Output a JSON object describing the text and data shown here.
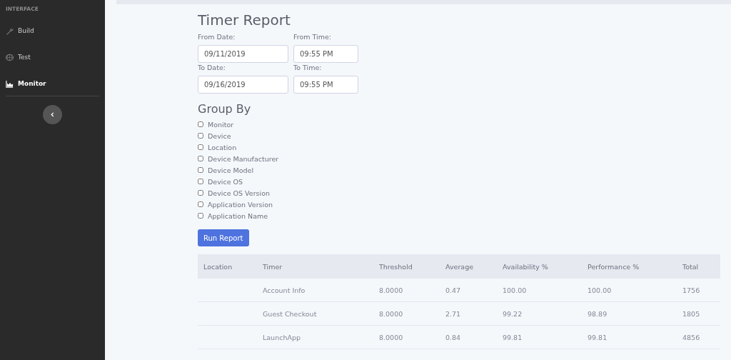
{
  "sidebar": {
    "heading": "INTERFACE",
    "items": [
      {
        "label": "Build",
        "selected": false
      },
      {
        "label": "Test",
        "selected": false
      },
      {
        "label": "Monitor",
        "selected": true
      }
    ]
  },
  "page": {
    "title": "Timer Report",
    "fields": [
      {
        "label": "From Date:",
        "value": "09/11/2019"
      },
      {
        "label": "From Time:",
        "value": "09:55 PM"
      },
      {
        "label": "To Date:",
        "value": "09/16/2019"
      },
      {
        "label": "To Time:",
        "value": "09:55 PM"
      }
    ],
    "group_by": {
      "title": "Group By",
      "options": [
        {
          "label": "Monitor",
          "checked": false
        },
        {
          "label": "Device",
          "checked": false
        },
        {
          "label": "Location",
          "checked": false
        },
        {
          "label": "Device Manufacturer",
          "checked": false
        },
        {
          "label": "Device Model",
          "checked": false
        },
        {
          "label": "Device OS",
          "checked": false
        },
        {
          "label": "Device OS Version",
          "checked": false
        },
        {
          "label": "Application Version",
          "checked": false
        },
        {
          "label": "Application Name",
          "checked": false
        }
      ]
    },
    "run_button": "Run Report",
    "table": {
      "columns": [
        "Location",
        "Timer",
        "Threshold",
        "Average",
        "Availability %",
        "Performance %",
        "Total"
      ],
      "rows": [
        [
          "",
          "Account Info",
          "8.0000",
          "0.47",
          "100.00",
          "100.00",
          "1756"
        ],
        [
          "",
          "Guest Checkout",
          "8.0000",
          "2.71",
          "99.22",
          "98.89",
          "1805"
        ],
        [
          "",
          "LaunchApp",
          "8.0000",
          "0.84",
          "99.81",
          "99.81",
          "4856"
        ]
      ]
    }
  }
}
